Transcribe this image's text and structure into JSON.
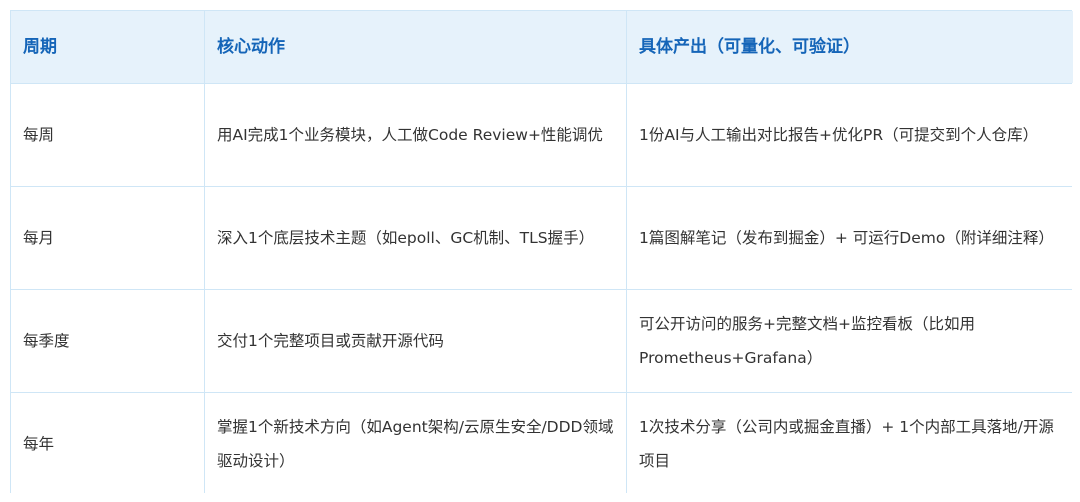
{
  "table": {
    "headers": [
      "周期",
      "核心动作",
      "具体产出（可量化、可验证）"
    ],
    "rows": [
      {
        "period": "每周",
        "action": "用AI完成1个业务模块，人工做Code Review+性能调优",
        "output": "1份AI与人工输出对比报告+优化PR（可提交到个人仓库）"
      },
      {
        "period": "每月",
        "action": "深入1个底层技术主题（如epoll、GC机制、TLS握手）",
        "output": "1篇图解笔记（发布到掘金）+ 可运行Demo（附详细注释）"
      },
      {
        "period": "每季度",
        "action": "交付1个完整项目或贡献开源代码",
        "output": "可公开访问的服务+完整文档+监控看板（比如用Prometheus+Grafana）"
      },
      {
        "period": "每年",
        "action": "掌握1个新技术方向（如Agent架构/云原生安全/DDD领域驱动设计）",
        "output": "1次技术分享（公司内或掘金直播）+ 1个内部工具落地/开源项目"
      }
    ]
  }
}
